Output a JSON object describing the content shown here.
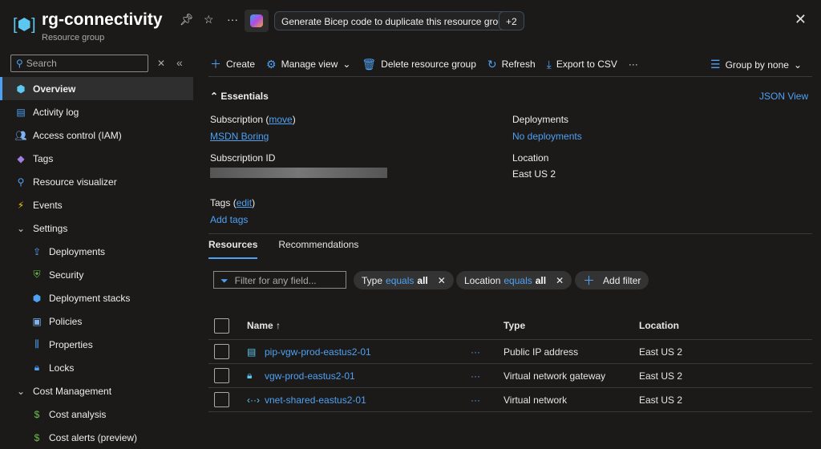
{
  "header": {
    "title": "rg-connectivity",
    "subtitle": "Resource group",
    "copilot_prompt": "Generate Bicep code to duplicate this resource group.",
    "more_prompts": "+2"
  },
  "sidebar": {
    "search_placeholder": "Search",
    "items": [
      {
        "label": "Overview",
        "icon": "resource-group-icon",
        "color": "#5cc8f0"
      },
      {
        "label": "Activity log",
        "icon": "activity-log-icon",
        "color": "#4ea1f3"
      },
      {
        "label": "Access control (IAM)",
        "icon": "people-icon",
        "color": "#7fb3f0"
      },
      {
        "label": "Tags",
        "icon": "tag-icon",
        "color": "#a17ee0"
      },
      {
        "label": "Resource visualizer",
        "icon": "visualizer-icon",
        "color": "#4ea1f3"
      },
      {
        "label": "Events",
        "icon": "lightning-icon",
        "color": "#f2c811"
      },
      {
        "label": "Settings",
        "group": true
      },
      {
        "label": "Deployments",
        "icon": "upload-icon",
        "color": "#4ea1f3"
      },
      {
        "label": "Security",
        "icon": "shield-icon",
        "color": "#6cc04a"
      },
      {
        "label": "Deployment stacks",
        "icon": "cube-icon",
        "color": "#4ea1f3"
      },
      {
        "label": "Policies",
        "icon": "policy-icon",
        "color": "#7fb3f0"
      },
      {
        "label": "Properties",
        "icon": "sliders-icon",
        "color": "#4ea1f3"
      },
      {
        "label": "Locks",
        "icon": "lock-icon",
        "color": "#4ea1f3"
      },
      {
        "label": "Cost Management",
        "group": true
      },
      {
        "label": "Cost analysis",
        "icon": "dollar-icon",
        "color": "#6cc04a"
      },
      {
        "label": "Cost alerts (preview)",
        "icon": "alert-icon",
        "color": "#6cc04a"
      }
    ]
  },
  "toolbar": {
    "create": "Create",
    "manage_view": "Manage view",
    "delete": "Delete resource group",
    "refresh": "Refresh",
    "export": "Export to CSV",
    "more": "···",
    "group_by": "Group by none"
  },
  "essentials": {
    "title": "Essentials",
    "json_view": "JSON View",
    "subscription_label": "Subscription",
    "move": "move",
    "subscription_value": "MSDN Boring",
    "subscription_id_label": "Subscription ID",
    "deployments_label": "Deployments",
    "deployments_value": "No deployments",
    "location_label": "Location",
    "location_value": "East US 2",
    "tags_label": "Tags",
    "edit": "edit",
    "add_tags": "Add tags"
  },
  "tabs": [
    "Resources",
    "Recommendations"
  ],
  "filters": {
    "placeholder": "Filter for any field...",
    "type_chip": {
      "key": "Type",
      "op": "equals",
      "val": "all"
    },
    "location_chip": {
      "key": "Location",
      "op": "equals",
      "val": "all"
    },
    "add_filter": "Add filter"
  },
  "table": {
    "headers": {
      "name": "Name ↑",
      "type": "Type",
      "location": "Location"
    },
    "rows": [
      {
        "name": "pip-vgw-prod-eastus2-01",
        "type": "Public IP address",
        "location": "East US 2",
        "icon": "public-ip-icon"
      },
      {
        "name": "vgw-prod-eastus2-01",
        "type": "Virtual network gateway",
        "location": "East US 2",
        "icon": "vpn-gateway-icon"
      },
      {
        "name": "vnet-shared-eastus2-01",
        "type": "Virtual network",
        "location": "East US 2",
        "icon": "vnet-icon"
      }
    ]
  }
}
